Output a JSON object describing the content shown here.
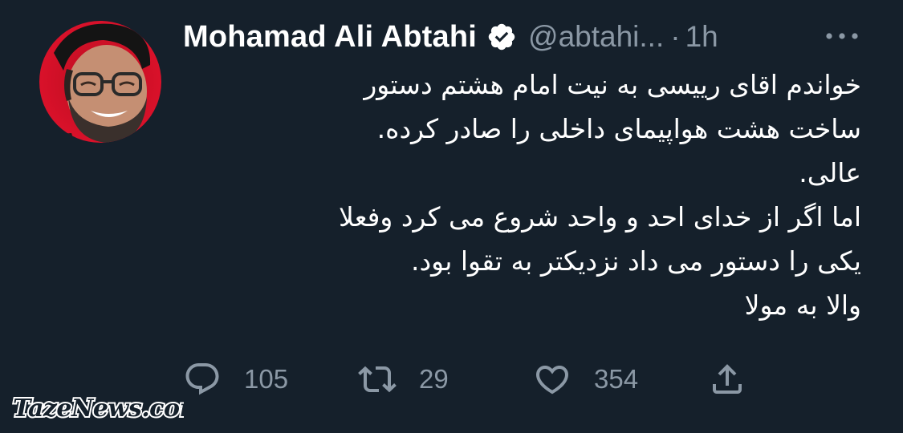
{
  "tweet": {
    "author": {
      "display_name": "Mohamad Ali Abtahi",
      "handle": "@abtahi...",
      "verified": true
    },
    "separator": "·",
    "time": "1h",
    "body_lines": [
      "خواندم اقای رییسی به نیت امام هشتم دستور",
      "ساخت هشت هواپیمای داخلی را صادر کرده.",
      "عالی.",
      "اما اگر از خدای احد و واحد شروع می کرد وفعلا",
      "یکی را دستور می داد نزدیکتر به تقوا بود.",
      "والا به مولا"
    ],
    "actions": {
      "reply_count": "105",
      "retweet_count": "29",
      "like_count": "354"
    }
  },
  "watermark": "TazeNews.com",
  "icons": {
    "avatar": "avatar-photo",
    "verified": "verified-badge-icon",
    "more": "more-options-icon",
    "reply": "reply-icon",
    "retweet": "retweet-icon",
    "like": "heart-icon",
    "share": "share-icon"
  },
  "colors": {
    "background": "#15202b",
    "text_primary": "#ffffff",
    "text_secondary": "#8b98a5",
    "avatar_ring": "#d8102a"
  }
}
